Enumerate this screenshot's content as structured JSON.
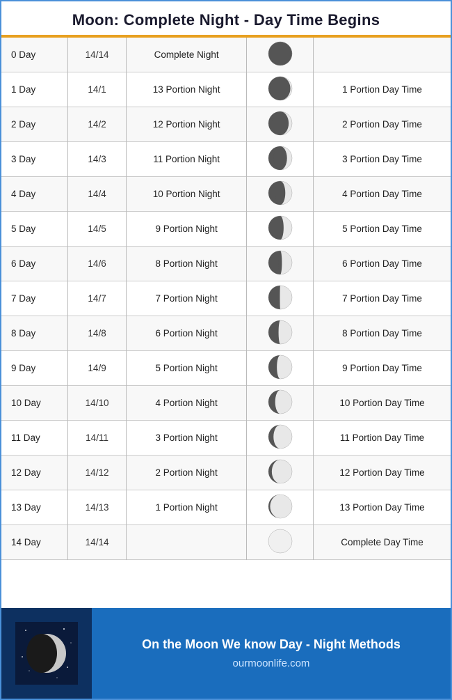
{
  "header": {
    "title": "Moon: Complete Night - Day Time Begins"
  },
  "rows": [
    {
      "day": "0 Day",
      "fraction": "14/14",
      "night": "Complete Night",
      "daytime": ""
    },
    {
      "day": "1 Day",
      "fraction": "14/1",
      "night": "13 Portion Night",
      "daytime": "1 Portion Day Time"
    },
    {
      "day": "2 Day",
      "fraction": "14/2",
      "night": "12 Portion Night",
      "daytime": "2 Portion Day Time"
    },
    {
      "day": "3 Day",
      "fraction": "14/3",
      "night": "11 Portion Night",
      "daytime": "3 Portion Day Time"
    },
    {
      "day": "4 Day",
      "fraction": "14/4",
      "night": "10 Portion Night",
      "daytime": "4 Portion Day Time"
    },
    {
      "day": "5 Day",
      "fraction": "14/5",
      "night": "9 Portion Night",
      "daytime": "5 Portion Day Time"
    },
    {
      "day": "6 Day",
      "fraction": "14/6",
      "night": "8 Portion Night",
      "daytime": "6 Portion Day Time"
    },
    {
      "day": "7 Day",
      "fraction": "14/7",
      "night": "7 Portion Night",
      "daytime": "7 Portion Day Time"
    },
    {
      "day": "8 Day",
      "fraction": "14/8",
      "night": "6 Portion Night",
      "daytime": "8 Portion Day Time"
    },
    {
      "day": "9 Day",
      "fraction": "14/9",
      "night": "5 Portion Night",
      "daytime": "9 Portion Day Time"
    },
    {
      "day": "10 Day",
      "fraction": "14/10",
      "night": "4 Portion Night",
      "daytime": "10 Portion Day Time"
    },
    {
      "day": "11 Day",
      "fraction": "14/11",
      "night": "3 Portion Night",
      "daytime": "11 Portion Day Time"
    },
    {
      "day": "12 Day",
      "fraction": "14/12",
      "night": "2 Portion Night",
      "daytime": "12 Portion Day Time"
    },
    {
      "day": "13 Day",
      "fraction": "14/13",
      "night": "1 Portion Night",
      "daytime": "13 Portion Day Time"
    },
    {
      "day": "14 Day",
      "fraction": "14/14",
      "night": "",
      "daytime": "Complete Day Time"
    }
  ],
  "moonPhases": [
    14,
    13,
    12,
    11,
    10,
    9,
    8,
    7,
    6,
    5,
    4,
    3,
    2,
    1,
    0
  ],
  "footer": {
    "tagline": "On the Moon We know Day - Night Methods",
    "url": "ourmoonlife.com"
  }
}
